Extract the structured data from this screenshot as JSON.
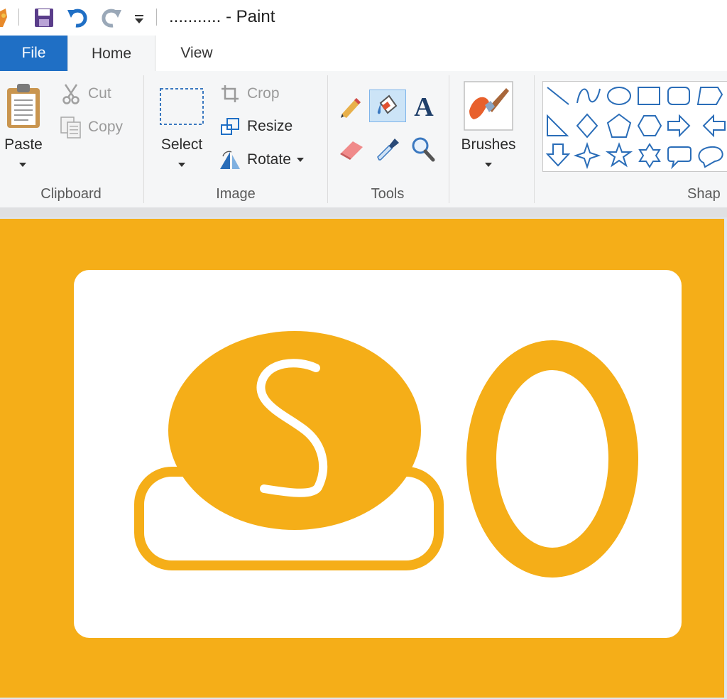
{
  "window": {
    "title": "........... - Paint"
  },
  "tabs": [
    {
      "label": "File"
    },
    {
      "label": "Home"
    },
    {
      "label": "View"
    }
  ],
  "ribbon": {
    "clipboard": {
      "paste_label": "Paste",
      "cut_label": "Cut",
      "copy_label": "Copy",
      "group_label": "Clipboard"
    },
    "image": {
      "select_label": "Select",
      "crop_label": "Crop",
      "resize_label": "Resize",
      "rotate_label": "Rotate",
      "group_label": "Image"
    },
    "tools": {
      "group_label": "Tools",
      "items": [
        "pencil-icon",
        "fill-icon",
        "text-icon",
        "eraser-icon",
        "color-picker-icon",
        "magnifier-icon"
      ]
    },
    "brushes": {
      "label": "Brushes"
    },
    "shapes": {
      "group_label": "Shap"
    }
  },
  "colors": {
    "accent": "#1f6fc5",
    "drawing_orange": "#f5ae18",
    "drawing_white": "#ffffff",
    "ribbon_bg": "#f5f6f7"
  },
  "canvas": {
    "letter": "S"
  }
}
